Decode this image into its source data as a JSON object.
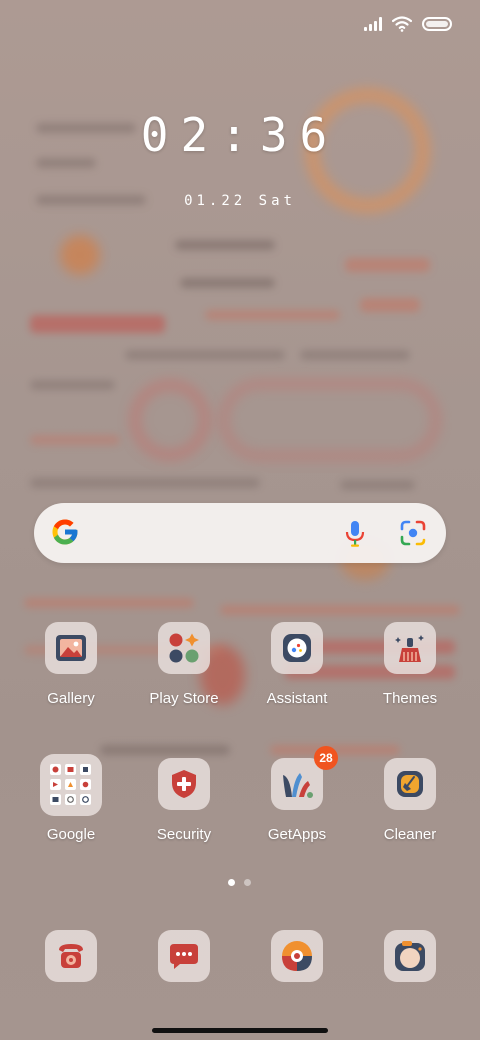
{
  "status_bar": {
    "icons": [
      "signal-icon",
      "wifi-icon",
      "battery-icon"
    ]
  },
  "clock": {
    "time": "02:36",
    "date": "01.22 Sat"
  },
  "search_bar": {
    "icons": [
      "google-icon",
      "mic-icon",
      "lens-icon"
    ]
  },
  "apps": [
    {
      "label": "Gallery"
    },
    {
      "label": "Play Store"
    },
    {
      "label": "Assistant"
    },
    {
      "label": "Themes"
    },
    {
      "label": "Google"
    },
    {
      "label": "Security"
    },
    {
      "label": "GetApps",
      "badge": "28"
    },
    {
      "label": "Cleaner"
    }
  ],
  "dock": {
    "apps": [
      "phone-icon",
      "messages-icon",
      "browser-icon",
      "camera-icon"
    ]
  },
  "page_indicator": {
    "count": 2,
    "active": 1
  },
  "colors": {
    "wallpaper": "#a8968f",
    "accent_red": "#c8403a",
    "badge": "#f0541f"
  }
}
